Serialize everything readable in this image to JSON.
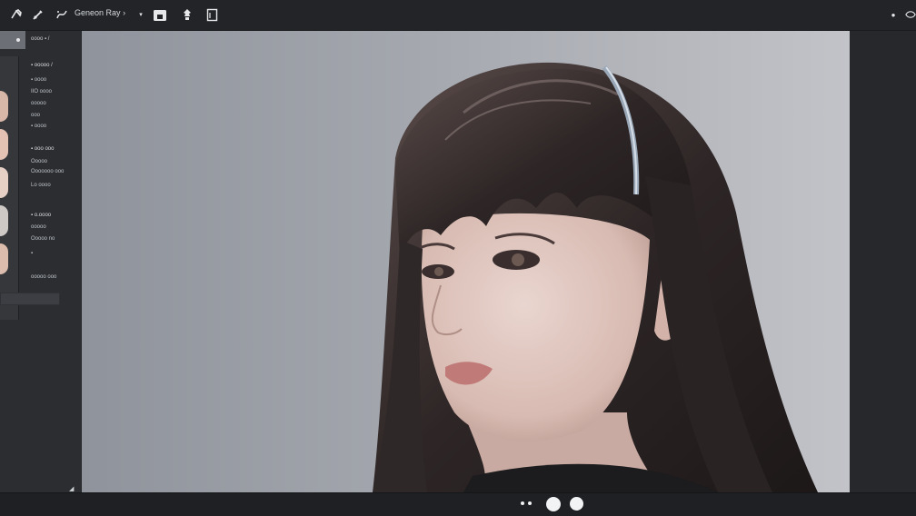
{
  "toolbar": {
    "title": "Geneon Ray",
    "title_chevron": "›",
    "icons": [
      "pen-icon",
      "brush-icon",
      "curve-icon",
      "dropdown-arrow-icon",
      "folder-icon",
      "stamp-icon",
      "document-icon",
      "status-dot-icon",
      "eye-icon"
    ]
  },
  "left_panel": {
    "header": "oooo ▪ /",
    "section_1": "▪ ooooo /",
    "items_1": [
      "▪ oooo",
      "IIO oooo",
      "ooooo",
      "ooo",
      "▪ oooo"
    ],
    "section_2": "▪ ooo ooo",
    "items_2": [
      "Ooooo",
      "Ooooooo ooo",
      "Lo oooo"
    ],
    "section_3": "▪ o.oooo",
    "items_3": [
      "ooooo",
      "Ooooo no"
    ],
    "item_4": "▪",
    "footer": "ooooo ooo"
  },
  "colors": {
    "toolbar_bg": "#222427",
    "panel_bg": "#2b2d31",
    "canvas_bg": "#9c9fa6"
  }
}
